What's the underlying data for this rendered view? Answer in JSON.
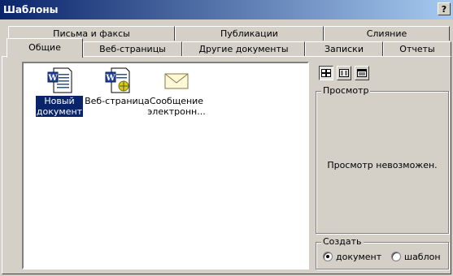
{
  "window": {
    "title": "Шаблоны",
    "help_label": "?"
  },
  "tabs_back": [
    {
      "label": "Письма и факсы"
    },
    {
      "label": "Публикации"
    },
    {
      "label": "Слияние"
    }
  ],
  "tabs_front": [
    {
      "label": "Общие",
      "active": true
    },
    {
      "label": "Веб-страницы"
    },
    {
      "label": "Другие документы"
    },
    {
      "label": "Записки"
    },
    {
      "label": "Отчеты"
    }
  ],
  "templates": [
    {
      "label_line1": "Новый",
      "label_line2": "документ",
      "icon": "word-document-icon",
      "selected": true
    },
    {
      "label_line1": "Веб-страница",
      "label_line2": "",
      "icon": "word-web-page-icon",
      "selected": false
    },
    {
      "label_line1": "Сообщение",
      "label_line2": "электронн...",
      "icon": "envelope-icon",
      "selected": false
    }
  ],
  "view_buttons": [
    {
      "icon": "large-icons-view-icon",
      "pressed": true
    },
    {
      "icon": "list-view-icon",
      "pressed": false
    },
    {
      "icon": "details-view-icon",
      "pressed": false
    }
  ],
  "preview": {
    "title": "Просмотр",
    "message": "Просмотр невозможен."
  },
  "create": {
    "title": "Создать",
    "options": [
      {
        "label": "документ",
        "selected": true
      },
      {
        "label": "шаблон",
        "selected": false
      }
    ]
  },
  "colors": {
    "title_bar": "#0a246a",
    "selection": "#0a246a",
    "face": "#d4d0c8"
  }
}
